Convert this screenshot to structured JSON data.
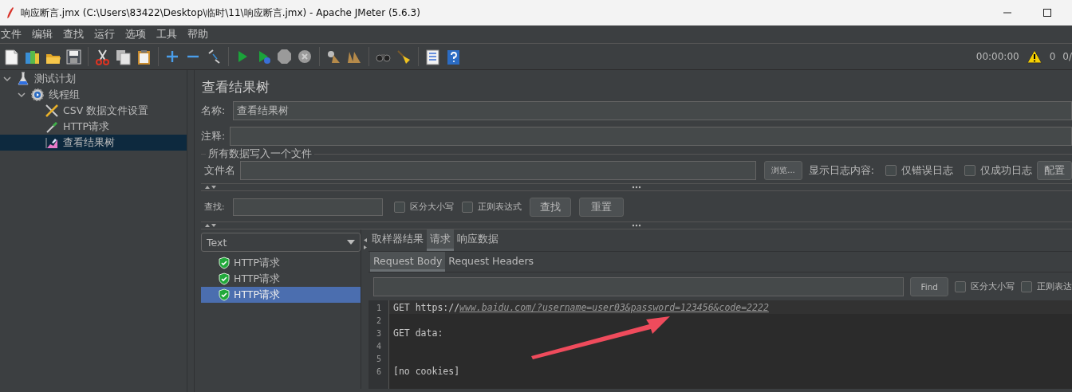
{
  "window": {
    "title": "响应断言.jmx (C:\\Users\\83422\\Desktop\\临时\\11\\响应断言.jmx) - Apache JMeter (5.6.3)"
  },
  "menu": [
    "文件",
    "编辑",
    "查找",
    "运行",
    "选项",
    "工具",
    "帮助"
  ],
  "status": {
    "timer": "00:00:00",
    "warnings": "0",
    "threads": "0/"
  },
  "tree": [
    {
      "label": "测试计划",
      "kind": "plan",
      "expanded": true,
      "selected": false,
      "children": [
        {
          "label": "线程组",
          "kind": "thread-group",
          "expanded": true,
          "selected": false,
          "children": [
            {
              "label": "CSV 数据文件设置",
              "kind": "config",
              "selected": false
            },
            {
              "label": "HTTP请求",
              "kind": "sampler",
              "selected": false
            },
            {
              "label": "查看结果树",
              "kind": "listener",
              "selected": true
            }
          ]
        }
      ]
    }
  ],
  "panel": {
    "title": "查看结果树",
    "name_label": "名称:",
    "name_value": "查看结果树",
    "comment_label": "注释:",
    "file_group": "所有数据写入一个文件",
    "file_label": "文件名",
    "browse": "浏览...",
    "log_label": "显示日志内容:",
    "log_options": [
      {
        "label": "仅错误日志",
        "checked": false
      },
      {
        "label": "仅成功日志",
        "checked": false
      }
    ],
    "configure": "配置"
  },
  "search": {
    "label": "查找:",
    "options": [
      {
        "label": "区分大小写",
        "checked": false
      },
      {
        "label": "正则表达式",
        "checked": false
      }
    ],
    "find": "查找",
    "reset": "重置"
  },
  "results": {
    "renderer": "Text",
    "samples": [
      {
        "label": "HTTP请求",
        "selected": false
      },
      {
        "label": "HTTP请求",
        "selected": false
      },
      {
        "label": "HTTP请求",
        "selected": true
      }
    ],
    "tabs": [
      {
        "label": "取样器结果",
        "selected": false
      },
      {
        "label": "请求",
        "selected": true
      },
      {
        "label": "响应数据",
        "selected": false
      }
    ],
    "subtabs": [
      {
        "label": "Request Body",
        "selected": true
      },
      {
        "label": "Request Headers",
        "selected": false
      }
    ],
    "find_button": "Find",
    "find_options": [
      {
        "label": "区分大小写",
        "checked": false
      },
      {
        "label": "正则表达",
        "checked": false
      }
    ],
    "lines": [
      {
        "number": "1",
        "text": "GET https://",
        "link": "www.baidu.com/?username=user03&password=123456&code=2222"
      },
      {
        "number": "2"
      },
      {
        "number": "3",
        "text": "GET data:"
      },
      {
        "number": "4"
      },
      {
        "number": "5"
      },
      {
        "number": "6",
        "text": "[no cookies]"
      }
    ]
  }
}
